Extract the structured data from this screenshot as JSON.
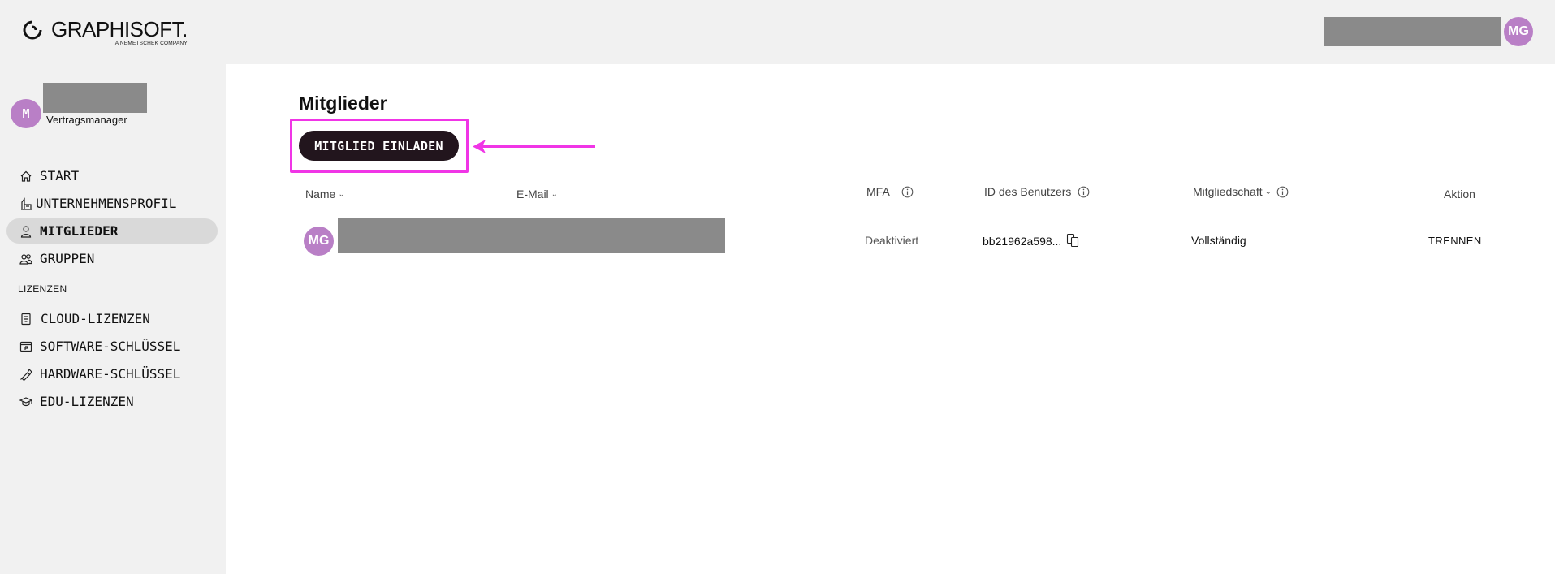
{
  "header": {
    "logo_name": "GRAPHISOFT.",
    "logo_sub": "A NEMETSCHEK COMPANY",
    "user_initials": "MG"
  },
  "sidebar": {
    "account_initial": "M",
    "account_role": "Vertragsmanager",
    "items": [
      {
        "label": "START",
        "icon": "home-icon"
      },
      {
        "label": "UNTERNEHMENSPROFIL",
        "icon": "building-icon"
      },
      {
        "label": "MITGLIEDER",
        "icon": "person-icon",
        "active": true
      },
      {
        "label": "GRUPPEN",
        "icon": "group-icon"
      }
    ],
    "section_label": "LIZENZEN",
    "license_items": [
      {
        "label": "CLOUD-LIZENZEN",
        "icon": "cloud-license-icon"
      },
      {
        "label": "SOFTWARE-SCHLÜSSEL",
        "icon": "software-key-icon"
      },
      {
        "label": "HARDWARE-SCHLÜSSEL",
        "icon": "hardware-key-icon"
      },
      {
        "label": "EDU-LIZENZEN",
        "icon": "graduation-cap-icon"
      }
    ]
  },
  "main": {
    "title": "Mitglieder",
    "invite_button": "MITGLIED EINLADEN",
    "columns": {
      "name": "Name",
      "email": "E-Mail",
      "mfa": "MFA",
      "user_id": "ID des Benutzers",
      "membership": "Mitgliedschaft",
      "action": "Aktion"
    },
    "rows": [
      {
        "initials": "MG",
        "mfa": "Deaktiviert",
        "user_id": "bb21962a598...",
        "membership": "Vollständig",
        "action": "TRENNEN"
      }
    ]
  },
  "colors": {
    "avatar": "#b97fc6",
    "highlight": "#f035e6",
    "button_bg": "#22151d",
    "sidebar_bg": "#f1f1f1",
    "active_bg": "#d9d9d9"
  }
}
